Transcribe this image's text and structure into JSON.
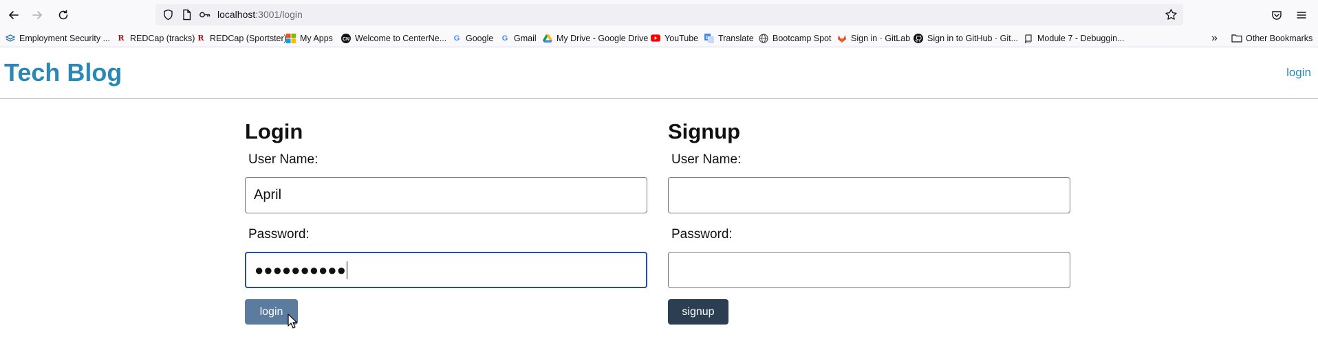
{
  "browser": {
    "url_host": "localhost",
    "url_path": ":3001/login",
    "icons": [
      "back-icon",
      "forward-icon",
      "reload-icon",
      "shield-icon",
      "page-icon",
      "key-icon",
      "bookmark-star-icon",
      "pocket-icon",
      "menu-icon"
    ]
  },
  "bookmarks": [
    {
      "label": "Employment Security ...",
      "icon": "layers-icon",
      "color": "#2a6fb0"
    },
    {
      "label": "REDCap (tracks)",
      "icon": "redcap-icon",
      "color": "#b7131b"
    },
    {
      "label": "REDCap (Sportster)",
      "icon": "redcap-icon",
      "color": "#b7131b"
    },
    {
      "label": "My Apps",
      "icon": "microsoft-icon",
      "color": "#f25022"
    },
    {
      "label": "Welcome to CenterNe...",
      "icon": "cn-icon",
      "color": "#111111"
    },
    {
      "label": "Google",
      "icon": "google-icon",
      "color": "#4285f4"
    },
    {
      "label": "Gmail",
      "icon": "google-icon",
      "color": "#4285f4"
    },
    {
      "label": "My Drive - Google Drive",
      "icon": "drive-icon",
      "color": "#0f9d58"
    },
    {
      "label": "YouTube",
      "icon": "youtube-icon",
      "color": "#ff0000"
    },
    {
      "label": "Translate",
      "icon": "translate-icon",
      "color": "#4285f4"
    },
    {
      "label": "Bootcamp Spot",
      "icon": "globe-icon",
      "color": "#444444"
    },
    {
      "label": "Sign in · GitLab",
      "icon": "gitlab-icon",
      "color": "#e24329"
    },
    {
      "label": "Sign in to GitHub · Git...",
      "icon": "github-icon",
      "color": "#111111"
    },
    {
      "label": "Module 7 - Debuggin...",
      "icon": "book-icon",
      "color": "#333333"
    }
  ],
  "other_bookmarks": "Other Bookmarks",
  "site": {
    "title": "Tech Blog",
    "nav_login": "login"
  },
  "login_form": {
    "title": "Login",
    "username_label": "User Name:",
    "username_value": "April",
    "password_label": "Password:",
    "password_mask": "●●●●●●●●●●",
    "button": "login"
  },
  "signup_form": {
    "title": "Signup",
    "username_label": "User Name:",
    "username_value": "",
    "password_label": "Password:",
    "password_value": "",
    "button": "signup"
  },
  "colors": {
    "brand": "#2a88b7",
    "login_button": "#5b7c9e",
    "signup_button": "#2c3e52",
    "focus_ring": "#1f4fae"
  }
}
